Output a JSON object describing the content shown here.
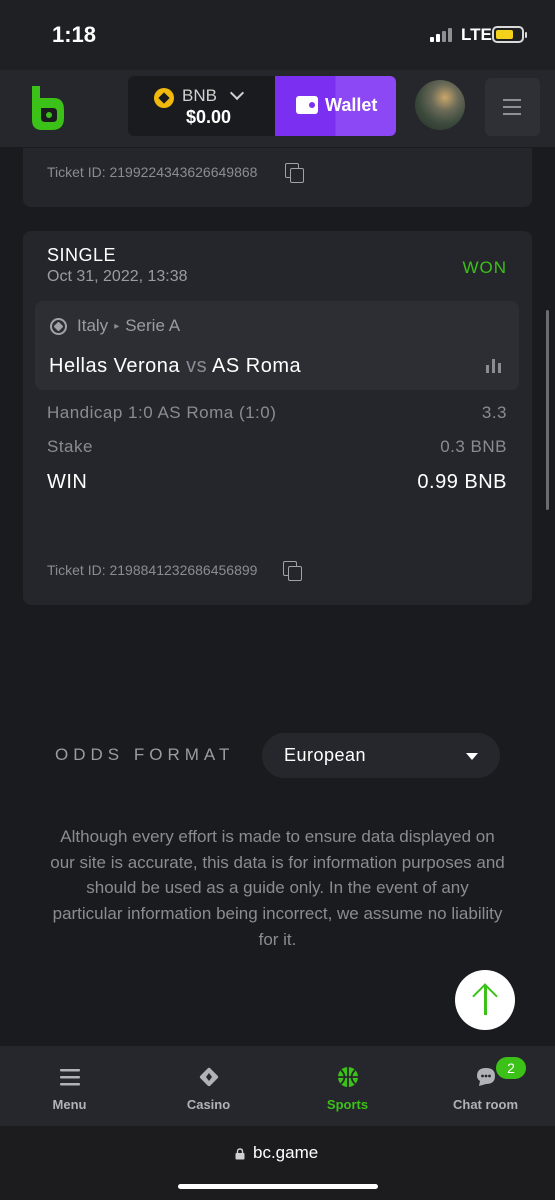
{
  "status_bar": {
    "time": "1:18",
    "network": "LTE"
  },
  "header": {
    "currency": "BNB",
    "balance": "$0.00",
    "wallet_label": "Wallet"
  },
  "previous_card": {
    "ticket_id": "Ticket ID: 2199224343626649868"
  },
  "bet_card": {
    "type": "SINGLE",
    "date": "Oct 31, 2022, 13:38",
    "status": "WON",
    "country": "Italy",
    "league": "Serie A",
    "home_team": "Hellas Verona",
    "vs": "vs",
    "away_team": "AS Roma",
    "market": "Handicap 1:0 AS Roma (1:0)",
    "odds": "3.3",
    "stake_label": "Stake",
    "stake_value": "0.3 BNB",
    "win_label": "WIN",
    "win_value": "0.99 BNB",
    "ticket_id": "Ticket ID: 2198841232686456899"
  },
  "odds_format": {
    "label": "ODDS FORMAT",
    "value": "European"
  },
  "disclaimer": "Although every effort is made to ensure data displayed on our site is accurate, this data is for information purposes and should be used as a guide only. In the event of any particular information being incorrect, we assume no liability for it.",
  "bottom_nav": {
    "items": [
      {
        "label": "Menu",
        "icon": "menu-icon"
      },
      {
        "label": "Casino",
        "icon": "casino-icon"
      },
      {
        "label": "Sports",
        "icon": "sports-icon"
      },
      {
        "label": "Chat room",
        "icon": "chat-icon"
      }
    ],
    "chat_badge": "2",
    "active": "Sports"
  },
  "url_bar": {
    "url": "bc.game"
  },
  "colors": {
    "accent_green": "#3bc117",
    "wallet_purple": "#7b2ff0",
    "background": "#1a1b1f"
  }
}
